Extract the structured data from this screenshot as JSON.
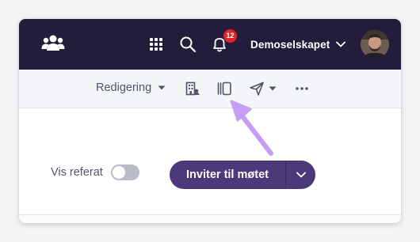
{
  "header": {
    "org_name": "Demoselskapet",
    "notifications_count": "12",
    "icons": [
      "people-logo-icon",
      "apps-grid-icon",
      "search-icon",
      "bell-icon",
      "chevron-down-icon"
    ]
  },
  "toolbar": {
    "edit_mode_label": "Redigering",
    "icons": [
      "building-icon",
      "side-panel-icon",
      "send-icon",
      "more-icon"
    ]
  },
  "content": {
    "toggle_label": "Vis referat",
    "toggle_on": false,
    "invite_label": "Inviter til møtet"
  },
  "colors": {
    "header_bg": "#231c3a",
    "primary": "#4a3a7a",
    "badge": "#e0242b",
    "annotation_arrow": "#c69cf4"
  }
}
